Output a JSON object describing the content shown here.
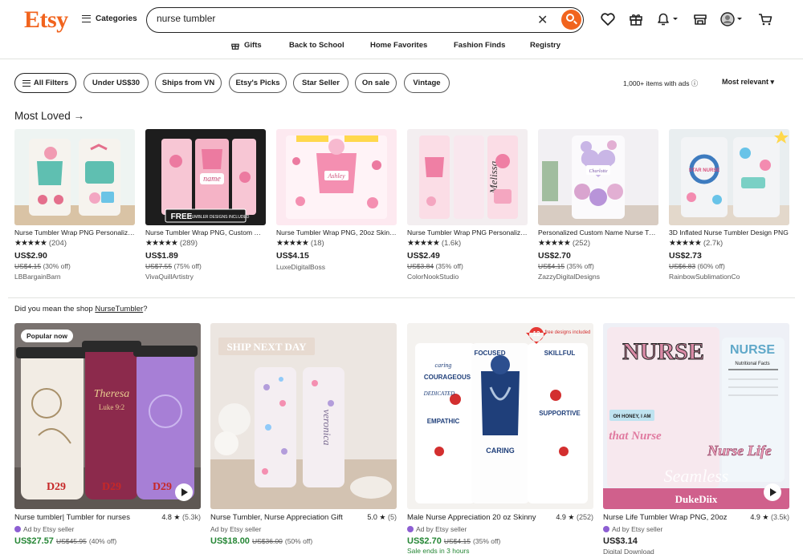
{
  "header": {
    "logo": "Etsy",
    "categories_label": "Categories",
    "search_value": "nurse tumbler",
    "subnav": [
      "Gifts",
      "Back to School",
      "Home Favorites",
      "Fashion Finds",
      "Registry"
    ]
  },
  "filters": {
    "chips": [
      "All Filters",
      "Under US$30",
      "Ships from VN",
      "Etsy's Picks",
      "Star Seller",
      "On sale",
      "Vintage"
    ],
    "ads_info": "1,000+ items with ads ⓘ",
    "sort": "Most relevant ▾"
  },
  "most_loved": {
    "title": "Most Loved →",
    "items": [
      {
        "title": "Nurse Tumbler Wrap PNG Personalized",
        "stars": "★★★★★",
        "reviews": "(204)",
        "price": "US$2.90",
        "orig": "US$4.15",
        "off": "(30% off)",
        "seller": "LBBargainBarn"
      },
      {
        "title": "Nurse Tumbler Wrap PNG, Custom Name",
        "stars": "★★★★★",
        "reviews": "(289)",
        "price": "US$1.89",
        "orig": "US$7.55",
        "off": "(75% off)",
        "seller": "VivaQuillArtistry"
      },
      {
        "title": "Nurse Tumbler Wrap PNG, 20oz Skinny",
        "stars": "★★★★★",
        "reviews": "(18)",
        "price": "US$4.15",
        "orig": "",
        "off": "",
        "seller": "LuxeDigitalBoss"
      },
      {
        "title": "Nurse Tumbler Wrap PNG Personalized",
        "stars": "★★★★★",
        "reviews": "(1.6k)",
        "price": "US$2.49",
        "orig": "US$3.84",
        "off": "(35% off)",
        "seller": "ColorNookStudio"
      },
      {
        "title": "Personalized Custom Name Nurse Tumbler",
        "stars": "★★★★★",
        "reviews": "(252)",
        "price": "US$2.70",
        "orig": "US$4.15",
        "off": "(35% off)",
        "seller": "ZazzyDigitalDesigns"
      },
      {
        "title": "3D Inflated Nurse Tumbler Design PNG",
        "stars": "★★★★★",
        "reviews": "(2.7k)",
        "price": "US$2.73",
        "orig": "US$6.83",
        "off": "(60% off)",
        "seller": "RainbowSublimationCo"
      }
    ]
  },
  "did_you_mean": {
    "prefix": "Did you mean the shop ",
    "shop": "NurseTumbler",
    "suffix": "?"
  },
  "listings": [
    {
      "title": "Nurse tumbler| Tumbler for nurses",
      "rating": "4.8 ★",
      "count": "(5.3k)",
      "ad": "Ad by Etsy seller",
      "price": "US$27.57",
      "orig": "US$45.95",
      "off": "(40% off)",
      "badge": "Popular now",
      "extra": "",
      "thumb_texts": [
        "Theresa",
        "Luke 9:2",
        "D29",
        "D29",
        "D29"
      ]
    },
    {
      "title": "Nurse Tumbler, Nurse Appreciation Gift",
      "rating": "5.0 ★",
      "count": "(5)",
      "ad": "Ad by Etsy seller",
      "price": "US$18.00",
      "orig": "US$36.00",
      "off": "(50% off)",
      "badge": "",
      "extra": "",
      "thumb_texts": [
        "SHIP NEXT DAY",
        "veronica"
      ]
    },
    {
      "title": "Male Nurse Appreciation 20 oz Skinny",
      "rating": "4.9 ★",
      "count": "(252)",
      "ad": "Ad by Etsy seller",
      "price": "US$2.70",
      "orig": "US$4.15",
      "off": "(35% off)",
      "badge": "",
      "extra": "Sale ends in 3 hours",
      "thumb_texts": [
        "12",
        "free designs included",
        "CARING",
        "FOCUSED",
        "SKILLFUL",
        "COURAGEOUS",
        "EMPATHIC",
        "SUPPORTIVE",
        "caring",
        "DEDICATED"
      ]
    },
    {
      "title": "Nurse Life Tumbler Wrap PNG, 20oz",
      "rating": "4.9 ★",
      "count": "(3.5k)",
      "ad": "Ad by Etsy seller",
      "price": "US$3.14",
      "orig": "",
      "off": "",
      "badge": "",
      "extra": "Digital Download",
      "thumb_texts": [
        "NURSE",
        "NURSE",
        "Nutritional Facts",
        "OH HONEY, I AM",
        "that Nurse",
        "Nurse Life",
        "Seamless",
        "DukeDiix"
      ]
    }
  ],
  "colors": {
    "brand": "#f1641e",
    "sale_green": "#258635",
    "ad_purple": "#8d5fd3"
  },
  "thumb_labels": {
    "card2_name": "name",
    "card2_banner": "FREE",
    "card2_banner_sub": "TUMBLER DESIGNS INCLUDED",
    "card3_name": "Ashley",
    "card4_name": "Melissa",
    "card5_name": "Charlotte",
    "card6_text": "STAR NURSE"
  }
}
